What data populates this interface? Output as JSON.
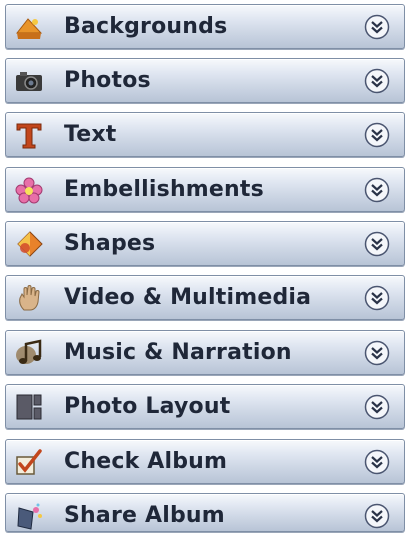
{
  "panel": {
    "items": [
      {
        "label": "Backgrounds",
        "icon": "backgrounds-icon"
      },
      {
        "label": "Photos",
        "icon": "camera-icon"
      },
      {
        "label": "Text",
        "icon": "text-t-icon"
      },
      {
        "label": "Embellishments",
        "icon": "flower-icon"
      },
      {
        "label": "Shapes",
        "icon": "shapes-icon"
      },
      {
        "label": "Video & Multimedia",
        "icon": "hand-icon"
      },
      {
        "label": "Music & Narration",
        "icon": "music-note-icon"
      },
      {
        "label": "Photo Layout",
        "icon": "layout-icon"
      },
      {
        "label": "Check Album",
        "icon": "checkmark-icon"
      },
      {
        "label": "Share Album",
        "icon": "share-icon"
      }
    ],
    "expand_icon": "chevron-double-down-icon"
  }
}
